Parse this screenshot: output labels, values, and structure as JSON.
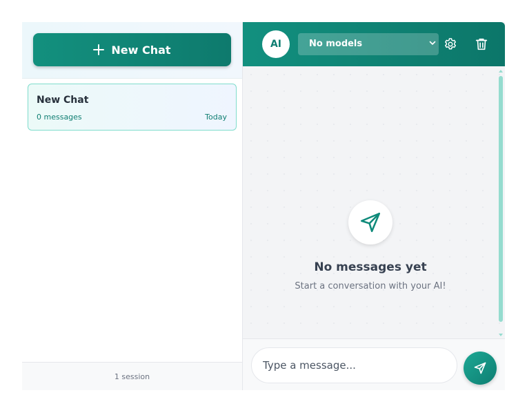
{
  "sidebar": {
    "new_chat_label": "New Chat",
    "sessions": [
      {
        "title": "New Chat",
        "count": "0 messages",
        "date": "Today"
      }
    ],
    "footer": "1 session"
  },
  "header": {
    "avatar_text": "AI",
    "model_selected": "No models"
  },
  "empty_state": {
    "title": "No messages yet",
    "subtitle": "Start a conversation with your AI!"
  },
  "composer": {
    "placeholder": "Type a message..."
  },
  "colors": {
    "accent": "#0f8a7a",
    "accent_light": "#7fdccc"
  },
  "icons": {
    "new_chat": "plus-icon",
    "settings": "gear-icon",
    "delete": "trash-icon",
    "send": "send-icon"
  }
}
